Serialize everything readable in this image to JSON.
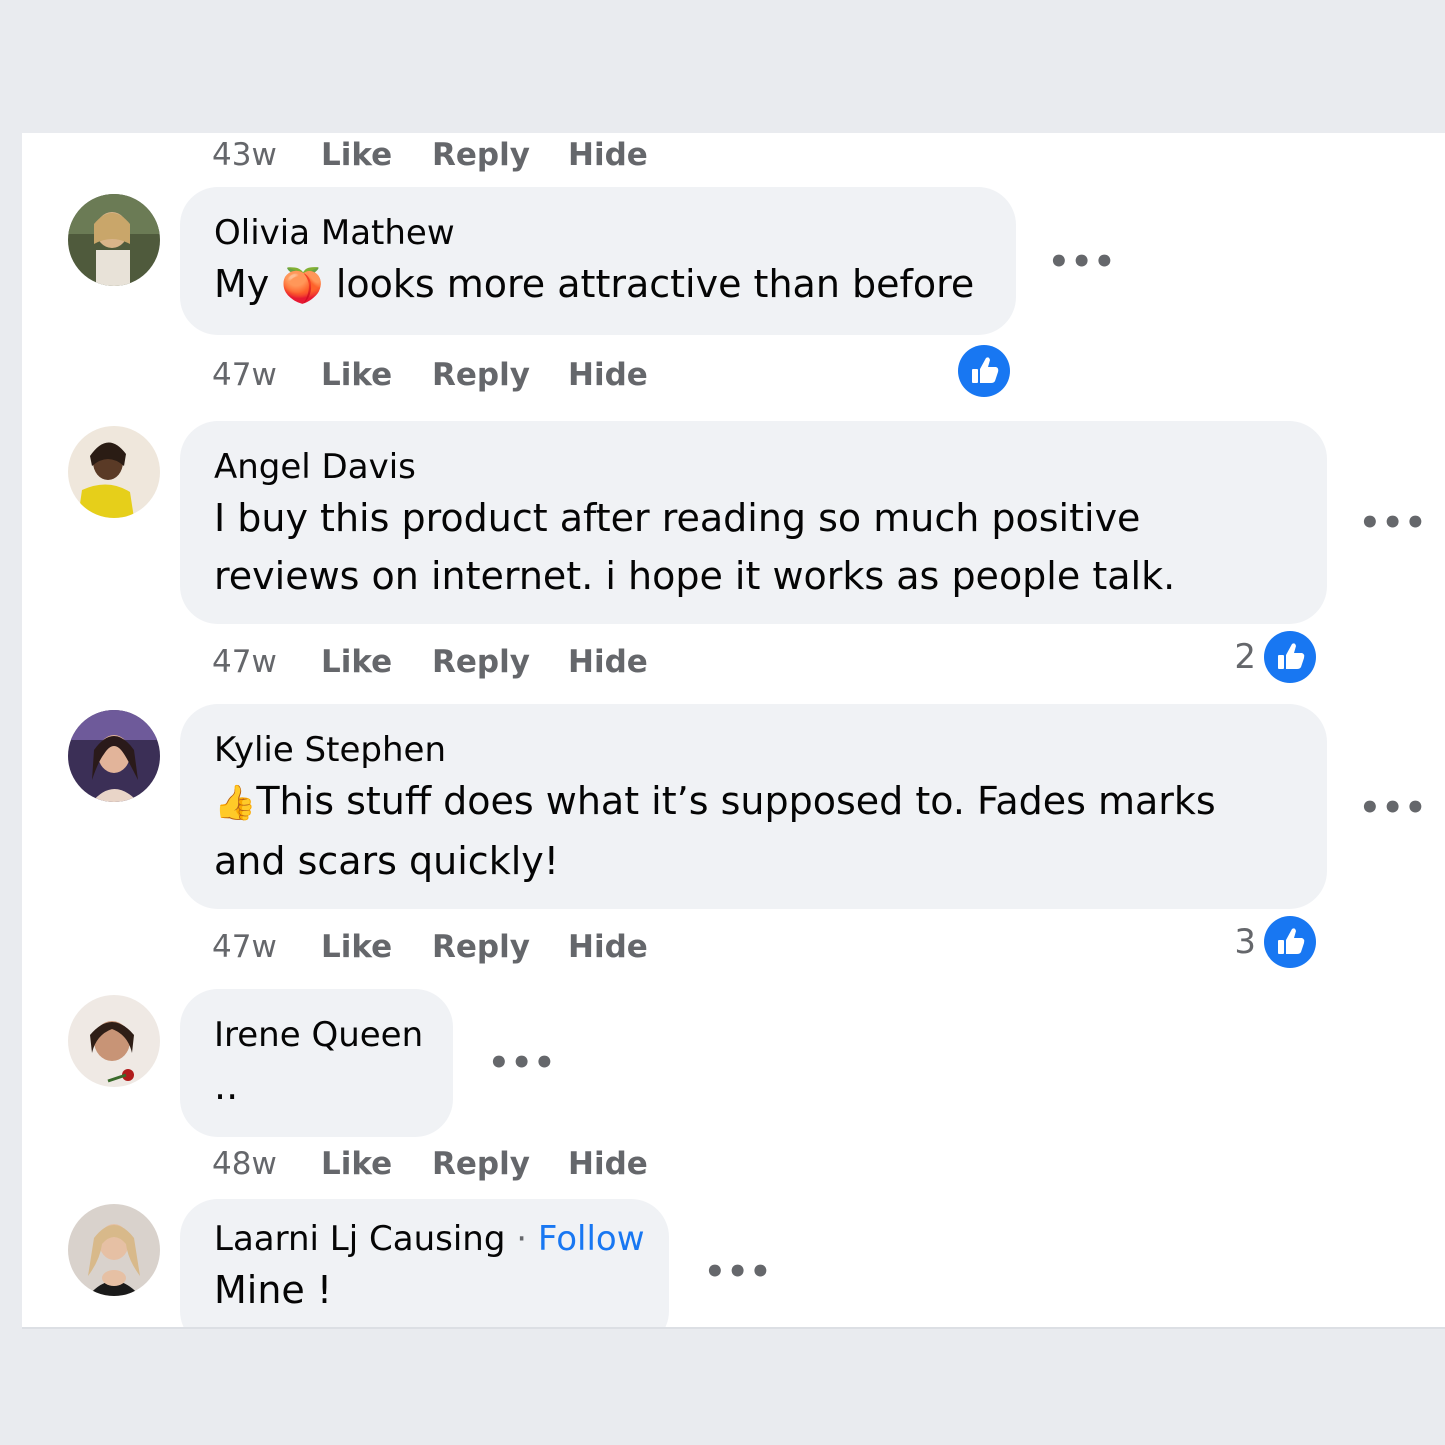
{
  "comments_top_actions": {
    "time": "43w",
    "like": "Like",
    "reply": "Reply",
    "hide": "Hide"
  },
  "comments": [
    {
      "author": "Olivia Mathew",
      "text_before_emoji": "My",
      "emoji": "🍑",
      "text_after_emoji": "looks more attractive than before",
      "time": "47w",
      "like": "Like",
      "reply": "Reply",
      "hide": "Hide",
      "reaction_count": "",
      "more": "•••"
    },
    {
      "author": "Angel Davis",
      "text": "I buy this product after reading so much positive reviews on internet. i hope it works as people talk.",
      "time": "47w",
      "like": "Like",
      "reply": "Reply",
      "hide": "Hide",
      "reaction_count": "2",
      "more": "•••"
    },
    {
      "author": "Kylie Stephen",
      "emoji": "👍",
      "text": "This stuff does what it’s supposed to. Fades marks and scars quickly!",
      "time": "47w",
      "like": "Like",
      "reply": "Reply",
      "hide": "Hide",
      "reaction_count": "3",
      "more": "•••"
    },
    {
      "author": "Irene Queen",
      "text": "..",
      "time": "48w",
      "like": "Like",
      "reply": "Reply",
      "hide": "Hide",
      "more": "•••"
    },
    {
      "author": "Laarni Lj Causing",
      "separator": "·",
      "follow": "Follow",
      "text": "Mine !",
      "more": "•••"
    }
  ],
  "colors": {
    "bubble": "#f0f2f5",
    "like_blue": "#1877f2",
    "muted_text": "#65676b",
    "page_bg": "#e9ebef"
  }
}
